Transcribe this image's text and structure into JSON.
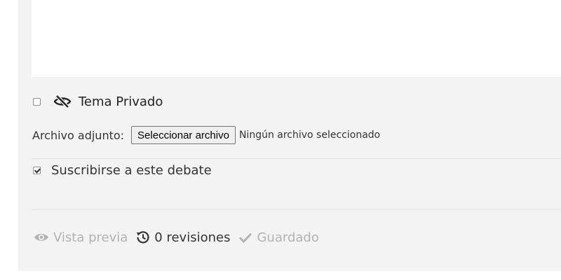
{
  "private_topic": {
    "label": "Tema Privado",
    "checked": false,
    "icon": "eye-slash-icon"
  },
  "attachment": {
    "label": "Archivo adjunto:",
    "button_label": "Seleccionar archivo",
    "status": "Ningún archivo seleccionado"
  },
  "subscribe": {
    "label": "Suscribirse a este debate",
    "checked": true
  },
  "footer": {
    "preview_label": "Vista previa",
    "revisions_label": "0 revisiones",
    "saved_label": "Guardado",
    "icons": [
      "eye-icon",
      "history-icon",
      "check-icon"
    ]
  },
  "colors": {
    "panel_bg": "#f3f3f3",
    "muted": "#b2b2b2",
    "text": "#333333"
  }
}
